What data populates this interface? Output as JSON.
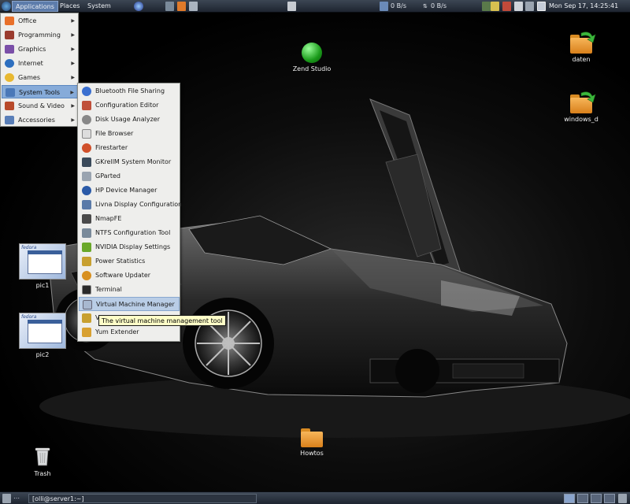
{
  "top_panel": {
    "menus": [
      "Applications",
      "Places",
      "System"
    ],
    "net_down": "0 B/s",
    "net_up": "0 B/s",
    "clock": "Mon Sep 17, 14:25:41"
  },
  "apps_menu": {
    "items": [
      {
        "label": "Office",
        "icon": "office-icon",
        "color": "#e8702a"
      },
      {
        "label": "Programming",
        "icon": "programming-icon",
        "color": "#9a3b2e"
      },
      {
        "label": "Graphics",
        "icon": "graphics-icon",
        "color": "#7a4fa8"
      },
      {
        "label": "Internet",
        "icon": "internet-icon",
        "color": "#2d6fbf"
      },
      {
        "label": "Games",
        "icon": "games-icon",
        "color": "#e8b830"
      },
      {
        "label": "System Tools",
        "icon": "system-tools-icon",
        "color": "#4a78b8"
      },
      {
        "label": "Sound & Video",
        "icon": "sound-video-icon",
        "color": "#b84a2a"
      },
      {
        "label": "Accessories",
        "icon": "accessories-icon",
        "color": "#5a7fb8"
      }
    ]
  },
  "system_tools_menu": {
    "items": [
      {
        "label": "Bluetooth File Sharing",
        "icon": "bluetooth-icon",
        "color": "#3a6fd0"
      },
      {
        "label": "Configuration Editor",
        "icon": "configuration-editor-icon",
        "color": "#c0503a"
      },
      {
        "label": "Disk Usage Analyzer",
        "icon": "disk-usage-icon",
        "color": "#888888"
      },
      {
        "label": "File Browser",
        "icon": "file-browser-icon",
        "color": "#dddddd"
      },
      {
        "label": "Firestarter",
        "icon": "firestarter-icon",
        "color": "#d0502a"
      },
      {
        "label": "GKrellM System Monitor",
        "icon": "gkrellm-icon",
        "color": "#3a4a5a"
      },
      {
        "label": "GParted",
        "icon": "gparted-icon",
        "color": "#9aa4b0"
      },
      {
        "label": "HP Device Manager",
        "icon": "hp-device-icon",
        "color": "#2a5aa8"
      },
      {
        "label": "Livna Display Configuration",
        "icon": "livna-display-icon",
        "color": "#5a7aa8"
      },
      {
        "label": "NmapFE",
        "icon": "nmapfe-icon",
        "color": "#4a4a4a"
      },
      {
        "label": "NTFS Configuration Tool",
        "icon": "ntfs-config-icon",
        "color": "#7a8a9a"
      },
      {
        "label": "NVIDIA Display Settings",
        "icon": "nvidia-icon",
        "color": "#6aa82a"
      },
      {
        "label": "Power Statistics",
        "icon": "power-statistics-icon",
        "color": "#c8a030"
      },
      {
        "label": "Software Updater",
        "icon": "software-updater-icon",
        "color": "#d89020"
      },
      {
        "label": "Terminal",
        "icon": "terminal-icon",
        "color": "#2a2a2a"
      },
      {
        "label": "Virtual Machine Manager",
        "icon": "vm-manager-icon",
        "color": "#a8b8d0"
      },
      {
        "label": "V",
        "icon": "volume-icon",
        "color": "#c8a030"
      },
      {
        "label": "Yum Extender",
        "icon": "yum-extender-icon",
        "color": "#d8a030"
      }
    ]
  },
  "tooltip": "The virtual machine management tool",
  "desktop_icons": [
    {
      "label": "Zend Studio"
    },
    {
      "label": "daten"
    },
    {
      "label": "windows_d"
    },
    {
      "label": "pic1"
    },
    {
      "label": "pic2"
    },
    {
      "label": "Howtos"
    },
    {
      "label": "Trash"
    }
  ],
  "taskbar": {
    "task_label": "[olli@server1:~]"
  },
  "colors": {
    "panel": "#2c3440",
    "menu_bg": "#eeeeec",
    "selection": "#86abd9",
    "tooltip_bg": "#ffffc8"
  }
}
